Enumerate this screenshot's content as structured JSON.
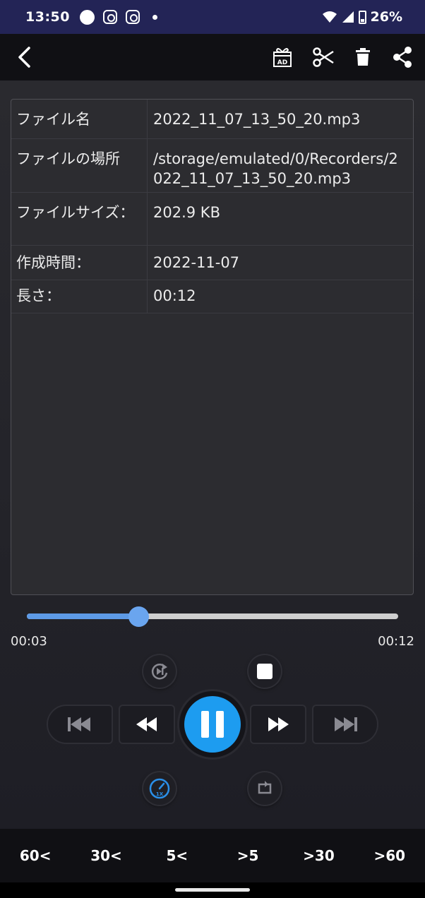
{
  "status_bar": {
    "time": "13:50",
    "battery_text": "26%"
  },
  "toolbar": {
    "icons": [
      "back-icon",
      "gift-ad-icon",
      "scissors-icon",
      "trash-icon",
      "share-icon"
    ],
    "ad_badge": "AD"
  },
  "file_info": {
    "rows": [
      {
        "label": "ファイル名",
        "value": "2022_11_07_13_50_20.mp3"
      },
      {
        "label": "ファイルの場所",
        "value": "/storage/emulated/0/Recorders/2022_11_07_13_50_20.mp3"
      },
      {
        "label": "ファイルサイズ：",
        "value": "202.9 KB"
      },
      {
        "label": "作成時間：",
        "value": "2022-11-07"
      },
      {
        "label": "長さ：",
        "value": "00:12"
      }
    ]
  },
  "player": {
    "current_time": "00:03",
    "total_time": "00:12",
    "progress_fraction": 0.3,
    "speed_badge": "1X",
    "accent_color": "#1d9cf0"
  },
  "skip_bar": {
    "buttons": [
      "60<",
      "30<",
      "5<",
      ">5",
      ">30",
      ">60"
    ]
  }
}
